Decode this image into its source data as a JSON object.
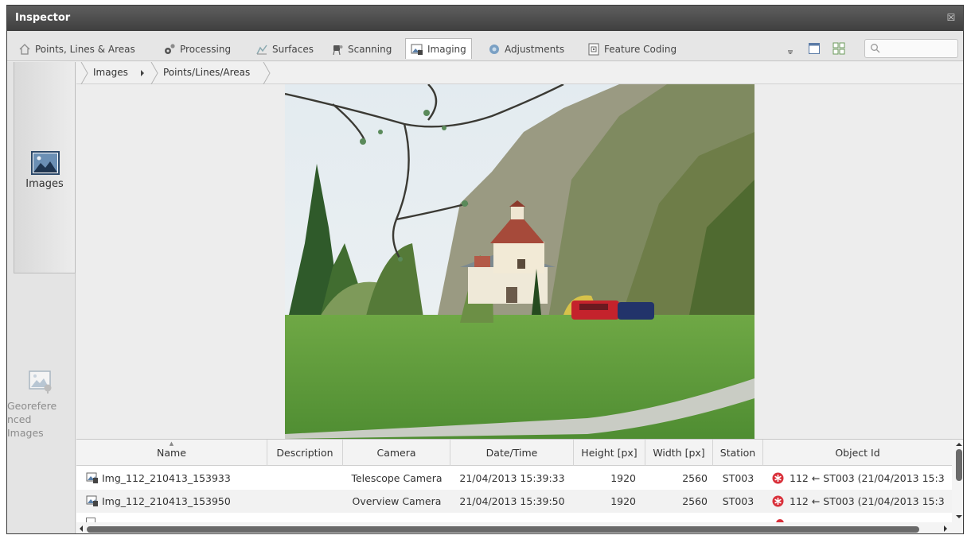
{
  "window": {
    "title": "Inspector",
    "close_glyph": "☒"
  },
  "tabs": [
    {
      "label": "Points, Lines & Areas",
      "icon": "home-shape-icon"
    },
    {
      "label": "Processing",
      "icon": "gears-icon"
    },
    {
      "label": "Surfaces",
      "icon": "surfaces-icon"
    },
    {
      "label": "Scanning",
      "icon": "scanner-icon"
    },
    {
      "label": "Imaging",
      "icon": "imaging-icon",
      "active": true
    },
    {
      "label": "Adjustments",
      "icon": "adjustments-icon"
    },
    {
      "label": "Feature Coding",
      "icon": "feature-coding-icon"
    }
  ],
  "toolbar": {
    "search_placeholder": ""
  },
  "sidebar": {
    "images_label": "Images",
    "georef_label_lines": [
      "Georefere",
      "nced",
      "Images"
    ]
  },
  "breadcrumb": [
    "Images",
    "Points/Lines/Areas"
  ],
  "table": {
    "columns": [
      "Name",
      "Description",
      "Camera",
      "Date/Time",
      "Height [px]",
      "Width [px]",
      "Station",
      "Object Id"
    ],
    "rows": [
      {
        "name": "Img_112_210413_153933",
        "description": "",
        "camera": "Telescope Camera",
        "datetime": "21/04/2013 15:39:33",
        "height": "1920",
        "width": "2560",
        "station": "ST003",
        "object_id": "112 ← ST003 (21/04/2013 15:3"
      },
      {
        "name": "Img_112_210413_153950",
        "description": "",
        "camera": "Overview Camera",
        "datetime": "21/04/2013 15:39:50",
        "height": "1920",
        "width": "2560",
        "station": "ST003",
        "object_id": "112 ← ST003 (21/04/2013 15:3"
      }
    ]
  },
  "colors": {
    "accent_red": "#d9303a",
    "titlebar": "#4a4a4a",
    "grass": "#5f9a3a"
  }
}
